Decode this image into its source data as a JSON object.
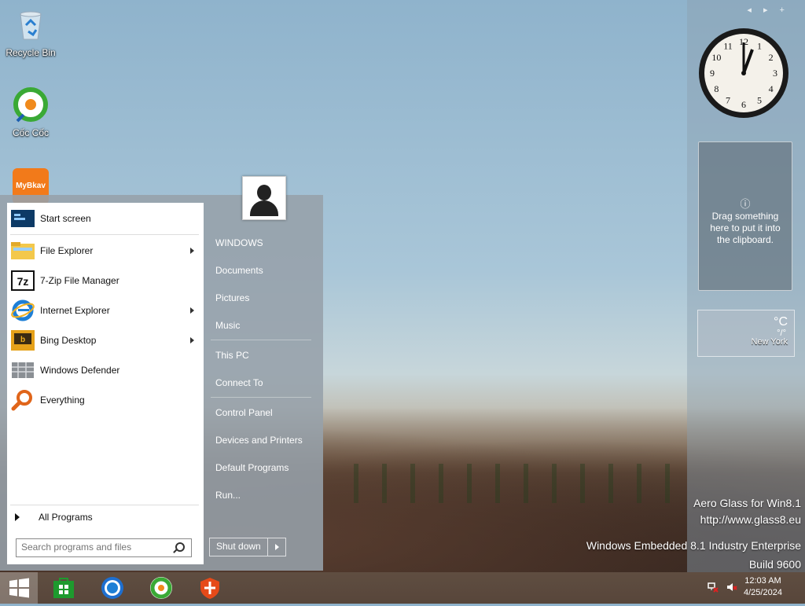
{
  "desktop": {
    "icons": [
      {
        "label": "Recycle Bin"
      },
      {
        "label": "Cốc Cốc"
      },
      {
        "label": "MyBkav"
      }
    ]
  },
  "gadgets": {
    "clipboard_text": "Drag something here to put it into the clipboard.",
    "weather": {
      "unit": "°C",
      "range": "°/°",
      "city": "New York"
    },
    "clock": {
      "numerals": [
        "12",
        "1",
        "2",
        "3",
        "4",
        "5",
        "6",
        "7",
        "8",
        "9",
        "10",
        "11"
      ]
    }
  },
  "watermark": {
    "line1": "Aero Glass for Win8.1",
    "line2": "http://www.glass8.eu",
    "line3": "Windows Embedded 8.1 Industry Enterprise",
    "line4": "Build 9600"
  },
  "start_menu": {
    "programs": [
      {
        "label": "Start screen",
        "has_submenu": false
      },
      {
        "label": "File Explorer",
        "has_submenu": true
      },
      {
        "label": "7-Zip File Manager",
        "has_submenu": false
      },
      {
        "label": "Internet Explorer",
        "has_submenu": true
      },
      {
        "label": "Bing Desktop",
        "has_submenu": true
      },
      {
        "label": "Windows Defender",
        "has_submenu": false
      },
      {
        "label": "Everything",
        "has_submenu": false
      }
    ],
    "all_programs": "All Programs",
    "search_placeholder": "Search programs and files",
    "places": [
      "WINDOWS",
      "Documents",
      "Pictures",
      "Music",
      "This PC",
      "Connect To",
      "Control Panel",
      "Devices and Printers",
      "Default Programs",
      "Run..."
    ],
    "shutdown_label": "Shut down"
  },
  "taskbar": {
    "time": "12:03 AM",
    "date": "4/25/2024"
  },
  "colors": {
    "coccoc_green": "#3aa935",
    "bkav_orange": "#f27a1a",
    "ie_blue": "#1e7fd6"
  }
}
